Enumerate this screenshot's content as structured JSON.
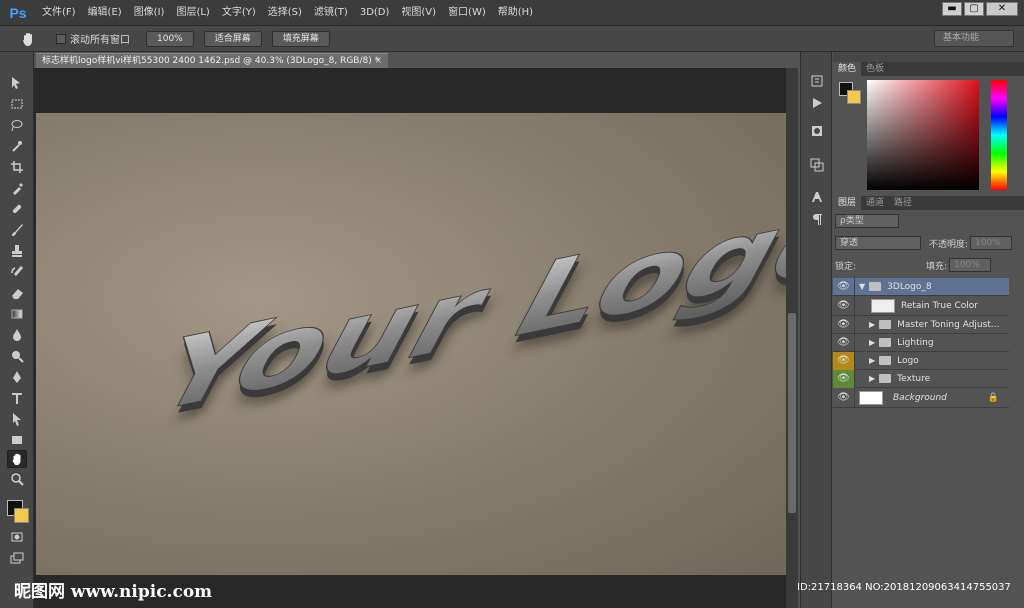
{
  "app": {
    "logo": "Ps"
  },
  "menu": [
    "文件(F)",
    "编辑(E)",
    "图像(I)",
    "图层(L)",
    "文字(Y)",
    "选择(S)",
    "滤镜(T)",
    "3D(D)",
    "视图(V)",
    "窗口(W)",
    "帮助(H)"
  ],
  "window_controls": {
    "minimize": "▬",
    "restore": "▢",
    "close": "✕"
  },
  "options_bar": {
    "tool_icon": "hand-icon",
    "scroll_all_label": "滚动所有窗口",
    "btn_100": "100%",
    "btn_fit": "适合屏幕",
    "btn_fill": "填充屏幕",
    "workspace": "基本功能"
  },
  "document": {
    "tab_title": "标志样机logo样机vi样机55300 2400 1462.psd @ 40.3% (3DLogo_8, RGB/8) *",
    "tab_close": "×",
    "logo_text": "Your Logo"
  },
  "color_panel": {
    "tabs": [
      "颜色",
      "色板"
    ],
    "fg_color": "#111111",
    "bg_color": "#f2c94c"
  },
  "layers_panel": {
    "tabs": [
      "图层",
      "通道",
      "路径"
    ],
    "filter_label": "ρ类型",
    "blend_mode": "穿透",
    "opacity_label": "不透明度:",
    "opacity_value": "100%",
    "lock_label": "锁定:",
    "fill_label": "填充:",
    "fill_value": "100%",
    "layers": [
      {
        "name": "3DLogo_8",
        "type": "group-open",
        "selected": true
      },
      {
        "name": "Retain True Color",
        "type": "smart"
      },
      {
        "name": "Master Toning Adjust...",
        "type": "group"
      },
      {
        "name": "Lighting",
        "type": "group"
      },
      {
        "name": "Logo",
        "type": "group",
        "eye_color": "#b38a1a"
      },
      {
        "name": "Texture",
        "type": "group",
        "eye_color": "#5f8a3a"
      },
      {
        "name": "Background",
        "type": "background"
      }
    ]
  },
  "watermark": {
    "left": "昵图网 www.nipic.com",
    "right": "ID:21718364 NO:20181209063414755037"
  }
}
